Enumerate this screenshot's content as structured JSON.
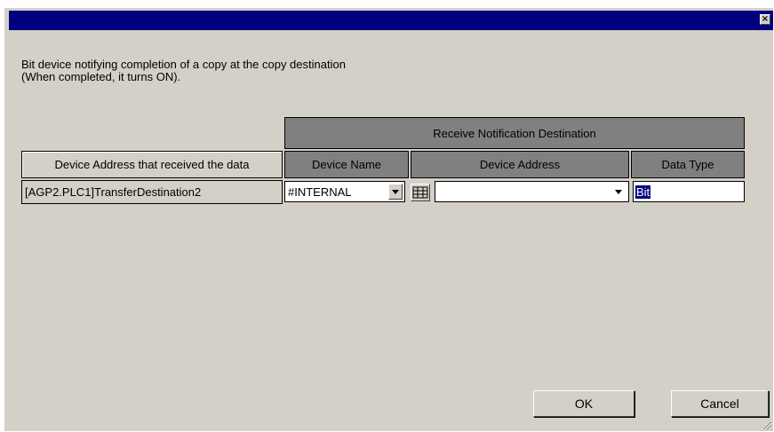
{
  "title_bar": {
    "close_glyph": "×"
  },
  "description": "Bit device notifying completion of a copy at the copy destination\n(When completed, it turns ON).",
  "table": {
    "group_header": "Receive Notification Destination",
    "col_received": "Device Address that received the data",
    "col_device_name": "Device Name",
    "col_device_address": "Device Address",
    "col_data_type": "Data Type",
    "row": {
      "received_address": "[AGP2.PLC1]TransferDestination2",
      "device_name": "#INTERNAL",
      "device_address": "",
      "data_type": "Bit"
    }
  },
  "buttons": {
    "ok": "OK",
    "cancel": "Cancel"
  },
  "colors": {
    "title_bar": "#000080",
    "dialog_bg": "#d4d0c8",
    "header_dark": "#808080",
    "selection": "#000080"
  }
}
